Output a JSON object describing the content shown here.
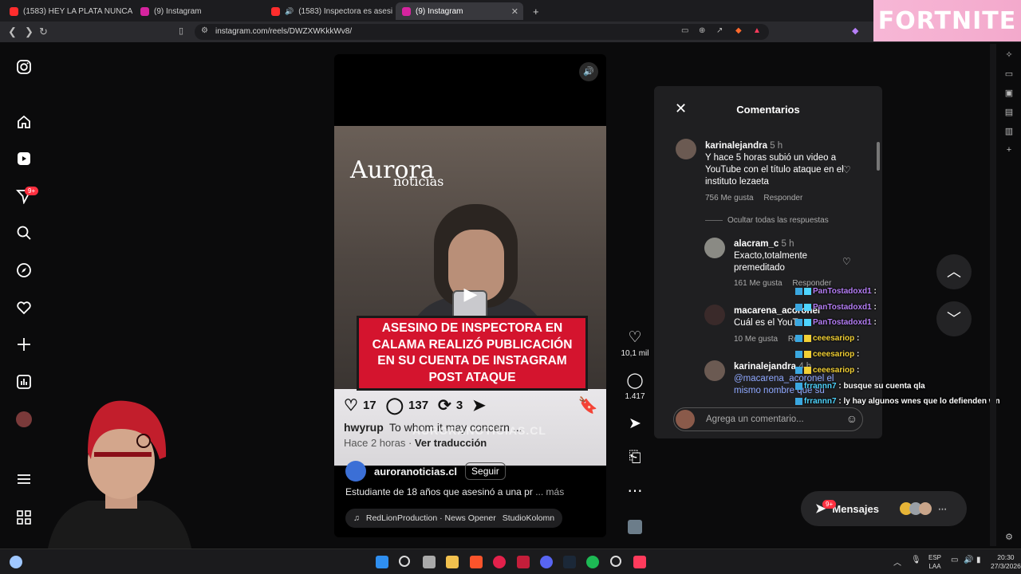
{
  "browser": {
    "tabs": [
      {
        "label": "(1583) HEY LA PLATA NUNCA",
        "color": "#ff2d2d"
      },
      {
        "label": "(9) Instagram",
        "color": "#d6249f"
      },
      {
        "label": "(1583) Inspectora es asesinada tr",
        "color": "#ff2d2d"
      },
      {
        "label": "(9) Instagram",
        "color": "#d6249f",
        "active": true
      }
    ],
    "new_tab": "+",
    "url": "instagram.com/reels/DWZXWKkkWv8/"
  },
  "banner": {
    "text": "FORTNITE"
  },
  "sidebar": {
    "icons": [
      "instagram-logo-icon",
      "home-icon",
      "reels-icon",
      "messages-icon",
      "search-icon",
      "explore-icon",
      "notifications-icon",
      "create-icon",
      "dashboard-icon",
      "profile-avatar",
      "menu-icon",
      "apps-icon"
    ],
    "messages_badge": "9+"
  },
  "reel": {
    "brand_top": "Aurora",
    "brand_bottom": "noticias",
    "headline": "ASESINO DE INSPECTORA EN CALAMA REALIZÓ PUBLICACIÓN EN SU CUENTA DE INSTAGRAM POST ATAQUE",
    "likes": "17",
    "comments": "137",
    "reposts": "3",
    "caption_user": "hwyrup",
    "caption_text": "To whom it may concern ...",
    "caption_time": "Hace 2 horas",
    "caption_translate": "Ver traducción",
    "watermark": "AURORANOTICIAS.CL",
    "account": "auroranoticias.cl",
    "follow_label": "Seguir",
    "description": "Estudiante de 18 años que asesinó a una pr",
    "description_more": "... más",
    "music": "RedLionProduction · News Opener",
    "music_2": "StudioKolomn"
  },
  "reel_actions": {
    "like_count": "10,1 mil",
    "comment_count": "1.417"
  },
  "comments_panel": {
    "title": "Comentarios",
    "items": [
      {
        "user": "karinalejandra",
        "time": "5 h",
        "text": "Y hace 5 horas subió un video a YouTube con el título ataque en el instituto lezaeta",
        "likes": "756 Me gusta",
        "reply": "Responder"
      },
      {
        "user": "alacram_c",
        "time": "5 h",
        "text": "Exacto,totalmente premeditado",
        "likes": "161 Me gusta",
        "reply": "Responder"
      },
      {
        "user": "macarena_acoronel",
        "time": "",
        "text": "Cuál es el YouT",
        "likes": "10 Me gusta",
        "reply": "Re"
      },
      {
        "user": "karinalejandra",
        "time": "4 h",
        "text": "@macarena_acoronel el mismo nombre que su",
        "likes": "",
        "reply": ""
      }
    ],
    "hide_replies": "Ocultar todas las respuestas",
    "input_placeholder": "Agrega un comentario..."
  },
  "chat": [
    {
      "user": "PanTostadoxd1",
      "msg": ":"
    },
    {
      "user": "PanTostadoxd1",
      "msg": ":"
    },
    {
      "user": "PanTostadoxd1",
      "msg": ":"
    },
    {
      "user": "ceeesariop",
      "msg": ":"
    },
    {
      "user": "ceeesariop",
      "msg": ":"
    },
    {
      "user": "ceeesariop",
      "msg": ":"
    },
    {
      "user": "frrannn7",
      "msg": ": busque su cuenta qla"
    },
    {
      "user": "frrannn7",
      "msg": ": ly hay algunos wnes que lo defienden wn"
    }
  ],
  "messages": {
    "label": "Mensajes",
    "badge": "9+"
  },
  "taskbar": {
    "lang_top": "ESP",
    "lang_bottom": "LAA",
    "time": "20:30",
    "date": "27/3/2026"
  }
}
